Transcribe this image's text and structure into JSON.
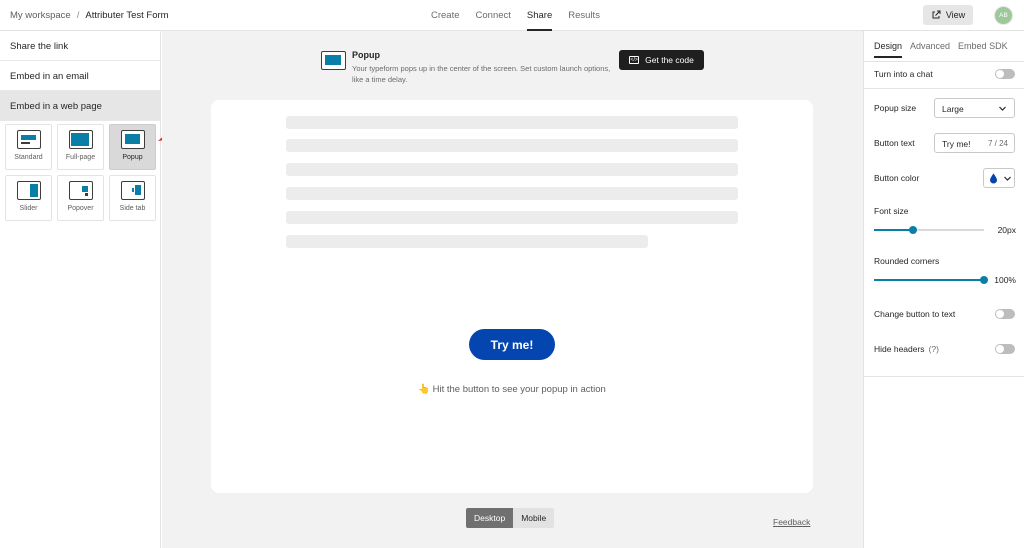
{
  "breadcrumb": {
    "workspace": "My workspace",
    "separator": "/",
    "form": "Attributer Test Form"
  },
  "nav": {
    "tabs": [
      "Create",
      "Connect",
      "Share",
      "Results"
    ],
    "active": "Share"
  },
  "header": {
    "view_label": "View",
    "avatar_initials": "AB"
  },
  "left": {
    "items": [
      "Share the link",
      "Embed in an email",
      "Embed in a web page"
    ],
    "embed_options": [
      "Standard",
      "Full-page",
      "Popup",
      "Slider",
      "Popover",
      "Side tab"
    ],
    "selected_option": "Popup"
  },
  "main": {
    "title": "Popup",
    "description": "Your typeform pops up in the center of the screen. Set custom launch options, like a time delay.",
    "code_button": "Get the code",
    "try_button": "Try me!",
    "hint": "👆 Hit the button to see your popup in action",
    "device_desktop": "Desktop",
    "device_mobile": "Mobile",
    "feedback": "Feedback"
  },
  "right": {
    "tabs": [
      "Design",
      "Advanced",
      "Embed SDK"
    ],
    "turn_into_chat": "Turn into a chat",
    "popup_size_label": "Popup size",
    "popup_size_value": "Large",
    "button_text_label": "Button text",
    "button_text_value": "Try me!",
    "button_text_count": "7 / 24",
    "button_color_label": "Button color",
    "font_size_label": "Font size",
    "font_size_value": "20px",
    "font_size_fraction": 0.35,
    "rounded_label": "Rounded corners",
    "rounded_value": "100%",
    "rounded_fraction": 1.0,
    "change_to_text": "Change button to text",
    "hide_headers": "Hide headers",
    "hide_headers_help": "(?)"
  },
  "colors": {
    "accent": "#0b7ea8",
    "button": "#0445af",
    "arrow": "#ff1a1a"
  }
}
